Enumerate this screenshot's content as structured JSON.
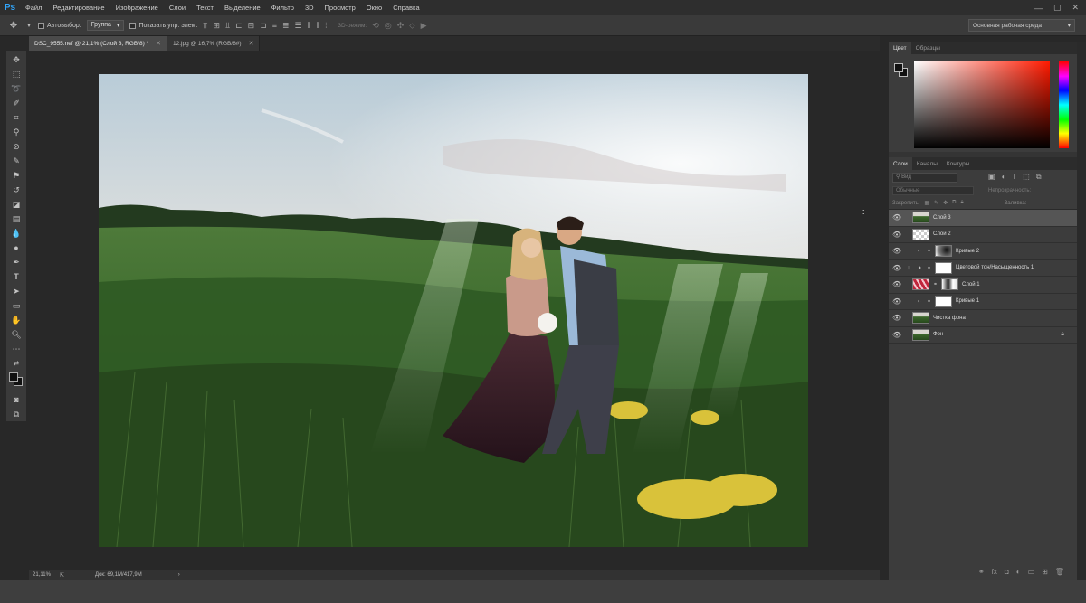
{
  "app": {
    "logo": "Ps"
  },
  "menu": [
    "Файл",
    "Редактирование",
    "Изображение",
    "Слои",
    "Текст",
    "Выделение",
    "Фильтр",
    "3D",
    "Просмотр",
    "Окно",
    "Справка"
  ],
  "window_controls": {
    "minimize": "—",
    "maximize": "▢",
    "close": "✕"
  },
  "options": {
    "autoselect_label": "Автовыбор:",
    "autoselect_value": "Группа",
    "show_controls_label": "Показать упр. элем.",
    "mode_3d": "3D-режим:",
    "workspace": "Основная рабочая среда"
  },
  "tabs": [
    {
      "label": "DSC_9555.nef @ 21,1% (Слой 3, RGB/8) *",
      "active": true
    },
    {
      "label": "12.jpg @ 16,7% (RGB/8#)",
      "active": false
    }
  ],
  "status": {
    "zoom": "21,11%",
    "doc": "Док: 69,1M/417,9M"
  },
  "color_panel": {
    "tabs": [
      "Цвет",
      "Образцы"
    ],
    "hue_color": "#ff1a00"
  },
  "layers_panel": {
    "tabs": [
      "Слои",
      "Каналы",
      "Контуры"
    ],
    "kind_placeholder": "Вид",
    "blend_mode": "Обычные",
    "opacity_label": "Непрозрачность:",
    "lock_label": "Закрепить:",
    "fill_label": "Заливка:",
    "layers": [
      {
        "name": "Слой 3",
        "type": "photo",
        "active": true
      },
      {
        "name": "Слой 2",
        "type": "transparent",
        "active": false
      },
      {
        "name": "Кривые 2",
        "type": "curves-dark",
        "active": false
      },
      {
        "name": "Цветовой тон/Насыщенность 1",
        "type": "hue-sat",
        "active": false
      },
      {
        "name": "Слой 1",
        "type": "red-pattern",
        "active": false
      },
      {
        "name": "Кривые 1",
        "type": "curves-white",
        "active": false
      },
      {
        "name": "Чистка фона",
        "type": "photo",
        "active": false
      },
      {
        "name": "Фон",
        "type": "photo-locked",
        "active": false
      }
    ],
    "footer_icons": [
      "link-icon",
      "fx-icon",
      "mask-icon",
      "adjustment-icon",
      "folder-icon",
      "new-layer-icon",
      "trash-icon"
    ]
  }
}
